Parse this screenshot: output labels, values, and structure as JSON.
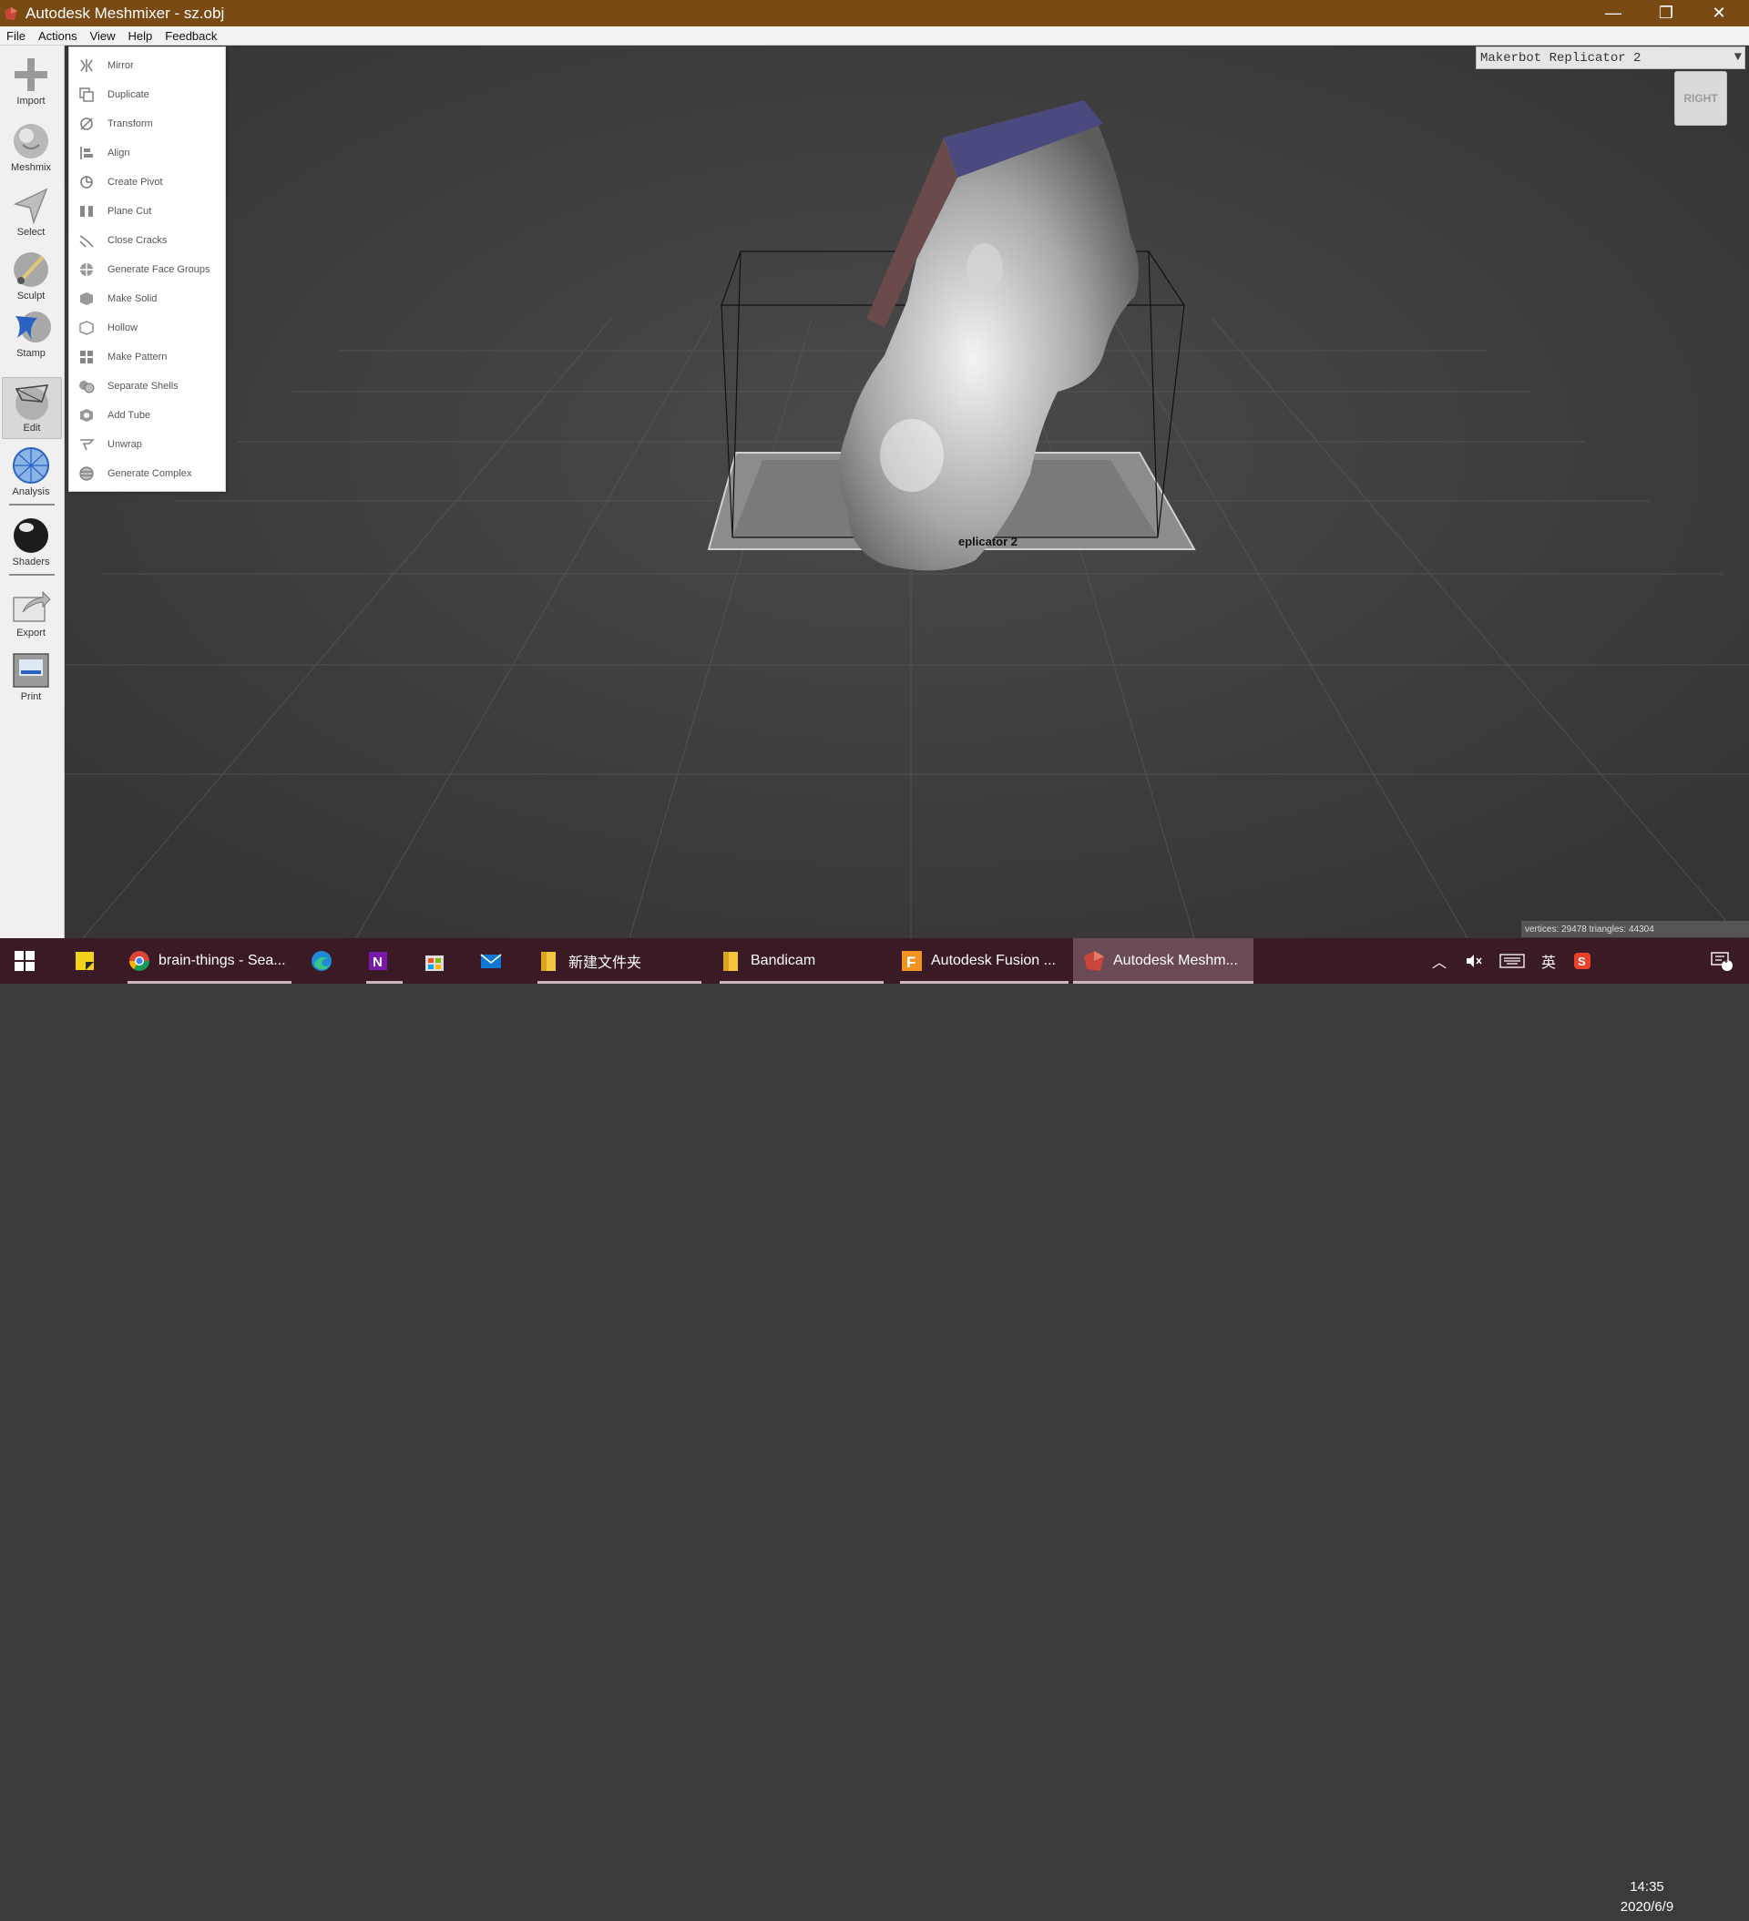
{
  "window": {
    "title": "Autodesk Meshmixer - sz.obj",
    "controls": {
      "minimize": "—",
      "restore": "❐",
      "close": "✕"
    }
  },
  "menubar": {
    "items": [
      "File",
      "Actions",
      "View",
      "Help",
      "Feedback"
    ]
  },
  "toolbar": {
    "tools": [
      {
        "label": "Import",
        "icon": "plus-icon"
      },
      {
        "label": "Meshmix",
        "icon": "meshmix-icon"
      },
      {
        "label": "Select",
        "icon": "select-arrow-icon"
      },
      {
        "label": "Sculpt",
        "icon": "sculpt-brush-icon"
      },
      {
        "label": "Stamp",
        "icon": "stamp-icon"
      },
      {
        "label": "Edit",
        "icon": "edit-icon",
        "active": true
      },
      {
        "label": "Analysis",
        "icon": "analysis-icon"
      },
      {
        "label": "Shaders",
        "icon": "shaders-sphere-icon"
      },
      {
        "label": "Export",
        "icon": "export-icon"
      },
      {
        "label": "Print",
        "icon": "print-icon"
      }
    ]
  },
  "edit_menu": {
    "items": [
      {
        "label": "Mirror",
        "icon": "mirror-icon"
      },
      {
        "label": "Duplicate",
        "icon": "duplicate-icon"
      },
      {
        "label": "Transform",
        "icon": "transform-icon"
      },
      {
        "label": "Align",
        "icon": "align-icon"
      },
      {
        "label": "Create Pivot",
        "icon": "pivot-icon"
      },
      {
        "label": "Plane Cut",
        "icon": "plane-cut-icon"
      },
      {
        "label": "Close Cracks",
        "icon": "close-cracks-icon"
      },
      {
        "label": "Generate Face Groups",
        "icon": "face-groups-icon"
      },
      {
        "label": "Make Solid",
        "icon": "make-solid-icon"
      },
      {
        "label": "Hollow",
        "icon": "hollow-icon"
      },
      {
        "label": "Make Pattern",
        "icon": "pattern-icon"
      },
      {
        "label": "Separate Shells",
        "icon": "separate-shells-icon"
      },
      {
        "label": "Add Tube",
        "icon": "add-tube-icon"
      },
      {
        "label": "Unwrap",
        "icon": "unwrap-icon"
      },
      {
        "label": "Generate Complex",
        "icon": "complex-icon"
      }
    ]
  },
  "viewport": {
    "printer": "Makerbot Replicator 2",
    "bed_label": "eplicator 2",
    "viewcube_face": "RIGHT",
    "stats": "vertices: 29478 triangles: 44304"
  },
  "taskbar": {
    "items": [
      {
        "label": "",
        "icon": "windows-start-icon"
      },
      {
        "label": "",
        "icon": "sticky-notes-icon"
      },
      {
        "label": "brain-things - Sea...",
        "icon": "chrome-icon"
      },
      {
        "label": "",
        "icon": "edge-icon"
      },
      {
        "label": "",
        "icon": "onenote-icon"
      },
      {
        "label": "",
        "icon": "store-icon"
      },
      {
        "label": "",
        "icon": "mail-icon"
      },
      {
        "label": "新建文件夹",
        "icon": "folder-icon"
      },
      {
        "label": "Bandicam",
        "icon": "folder-icon"
      },
      {
        "label": "Autodesk Fusion ...",
        "icon": "fusion-icon"
      },
      {
        "label": "Autodesk Meshm...",
        "icon": "meshmixer-icon"
      }
    ],
    "tray": {
      "lang": "英",
      "time": "14:35",
      "date": "2020/6/9",
      "notifications": "4"
    }
  }
}
